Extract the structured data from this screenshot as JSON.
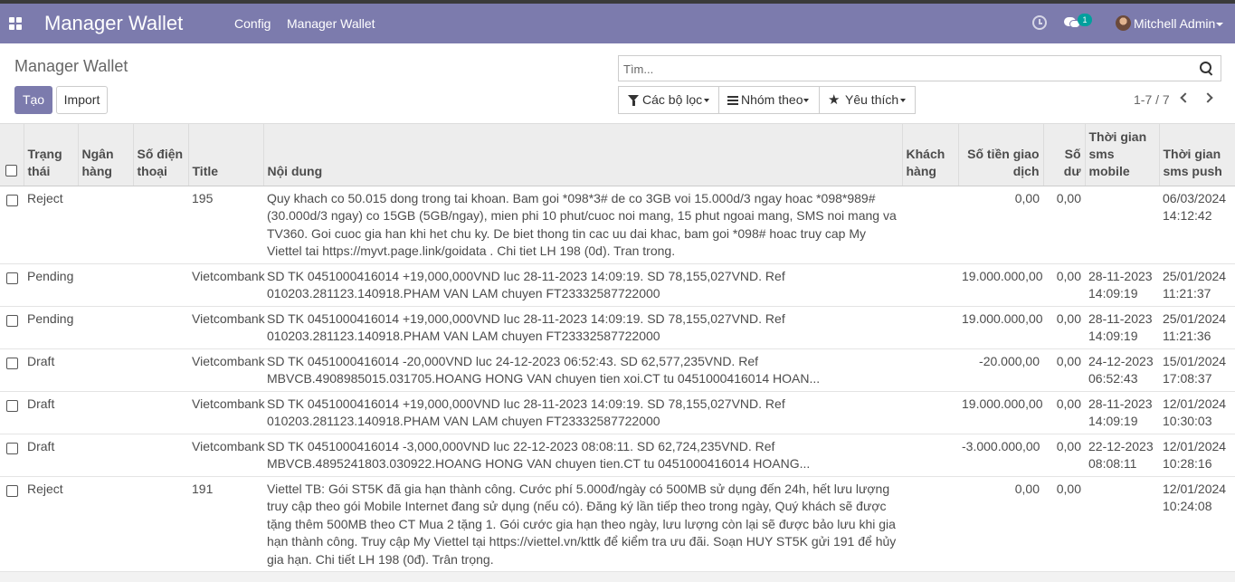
{
  "navbar": {
    "brand": "Manager Wallet",
    "menu": [
      "Config",
      "Manager Wallet"
    ],
    "chat_count": "1",
    "user_name": "Mitchell Admin"
  },
  "page": {
    "title": "Manager Wallet",
    "create_label": "Tạo",
    "import_label": "Import"
  },
  "search": {
    "placeholder": "Tìm..."
  },
  "filters": {
    "filter_label": "Các bộ lọc",
    "group_label": "Nhóm theo",
    "favorites_label": "Yêu thích"
  },
  "pager": {
    "text": "1-7 / 7"
  },
  "table": {
    "columns": {
      "status": "Trạng thái",
      "bank": "Ngân hàng",
      "phone": "Số điện thoại",
      "title": "Title",
      "content": "Nội dung",
      "customer": "Khách hàng",
      "amount": "Số tiền giao dịch",
      "balance": "Số dư",
      "sms_mobile_time": "Thời gian sms mobile",
      "sms_push_time": "Thời gian sms push"
    },
    "rows": [
      {
        "status": "Reject",
        "bank": "",
        "phone": "",
        "title": "195",
        "content": "Quy khach co 50.015 dong trong tai khoan. Bam goi *098*3# de co 3GB voi 15.000d/3 ngay hoac *098*989# (30.000d/3 ngay) co 15GB (5GB/ngay), mien phi 10 phut/cuoc noi mang, 15 phut ngoai mang, SMS noi mang va TV360. Goi cuoc gia han khi het chu ky. De biet thong tin cac uu dai khac, bam goi *098# hoac truy cap My Viettel tai https://myvt.page.link/goidata . Chi tiet LH 198 (0d). Tran trong.",
        "customer": "",
        "amount": "0,00",
        "balance": "0,00",
        "sms_mobile_time": "",
        "sms_push_time": "06/03/2024 14:12:42"
      },
      {
        "status": "Pending",
        "bank": "",
        "phone": "",
        "title": "Vietcombank",
        "content": "SD TK 0451000416014 +19,000,000VND luc 28-11-2023 14:09:19. SD 78,155,027VND. Ref 010203.281123.140918.PHAM VAN LAM chuyen FT23332587722000",
        "customer": "",
        "amount": "19.000.000,00",
        "balance": "0,00",
        "sms_mobile_time": "28-11-2023 14:09:19",
        "sms_push_time": "25/01/2024 11:21:37"
      },
      {
        "status": "Pending",
        "bank": "",
        "phone": "",
        "title": "Vietcombank",
        "content": "SD TK 0451000416014 +19,000,000VND luc 28-11-2023 14:09:19. SD 78,155,027VND. Ref 010203.281123.140918.PHAM VAN LAM chuyen FT23332587722000",
        "customer": "",
        "amount": "19.000.000,00",
        "balance": "0,00",
        "sms_mobile_time": "28-11-2023 14:09:19",
        "sms_push_time": "25/01/2024 11:21:36"
      },
      {
        "status": "Draft",
        "bank": "",
        "phone": "",
        "title": "Vietcombank",
        "content": "SD TK 0451000416014 -20,000VND luc 24-12-2023 06:52:43. SD 62,577,235VND. Ref MBVCB.4908985015.031705.HOANG HONG VAN chuyen tien xoi.CT tu 0451000416014 HOAN...",
        "customer": "",
        "amount": "-20.000,00",
        "balance": "0,00",
        "sms_mobile_time": "24-12-2023 06:52:43",
        "sms_push_time": "15/01/2024 17:08:37"
      },
      {
        "status": "Draft",
        "bank": "",
        "phone": "",
        "title": "Vietcombank",
        "content": "SD TK 0451000416014 +19,000,000VND luc 28-11-2023 14:09:19. SD 78,155,027VND. Ref 010203.281123.140918.PHAM VAN LAM chuyen FT23332587722000",
        "customer": "",
        "amount": "19.000.000,00",
        "balance": "0,00",
        "sms_mobile_time": "28-11-2023 14:09:19",
        "sms_push_time": "12/01/2024 10:30:03"
      },
      {
        "status": "Draft",
        "bank": "",
        "phone": "",
        "title": "Vietcombank",
        "content": "SD TK 0451000416014 -3,000,000VND luc 22-12-2023 08:08:11. SD 62,724,235VND. Ref MBVCB.4895241803.030922.HOANG HONG VAN chuyen tien.CT tu 0451000416014 HOANG...",
        "customer": "",
        "amount": "-3.000.000,00",
        "balance": "0,00",
        "sms_mobile_time": "22-12-2023 08:08:11",
        "sms_push_time": "12/01/2024 10:28:16"
      },
      {
        "status": "Reject",
        "bank": "",
        "phone": "",
        "title": "191",
        "content": "Viettel TB: Gói ST5K đã gia hạn thành công. Cước phí 5.000đ/ngày có 500MB sử dụng đến 24h, hết lưu lượng truy cập theo gói Mobile Internet đang sử dụng (nếu có). Đăng ký lần tiếp theo trong ngày, Quý khách sẽ được tặng thêm 500MB theo CT Mua 2 tặng 1. Gói cước gia hạn theo ngày, lưu lượng còn lại sẽ được bảo lưu khi gia hạn thành công. Truy cập My Viettel tại https://viettel.vn/kttk để kiểm tra ưu đãi. Soạn HUY ST5K gửi 191 để hủy gia hạn. Chi tiết LH 198 (0đ). Trân trọng.",
        "customer": "",
        "amount": "0,00",
        "balance": "0,00",
        "sms_mobile_time": "",
        "sms_push_time": "12/01/2024 10:24:08"
      }
    ]
  }
}
